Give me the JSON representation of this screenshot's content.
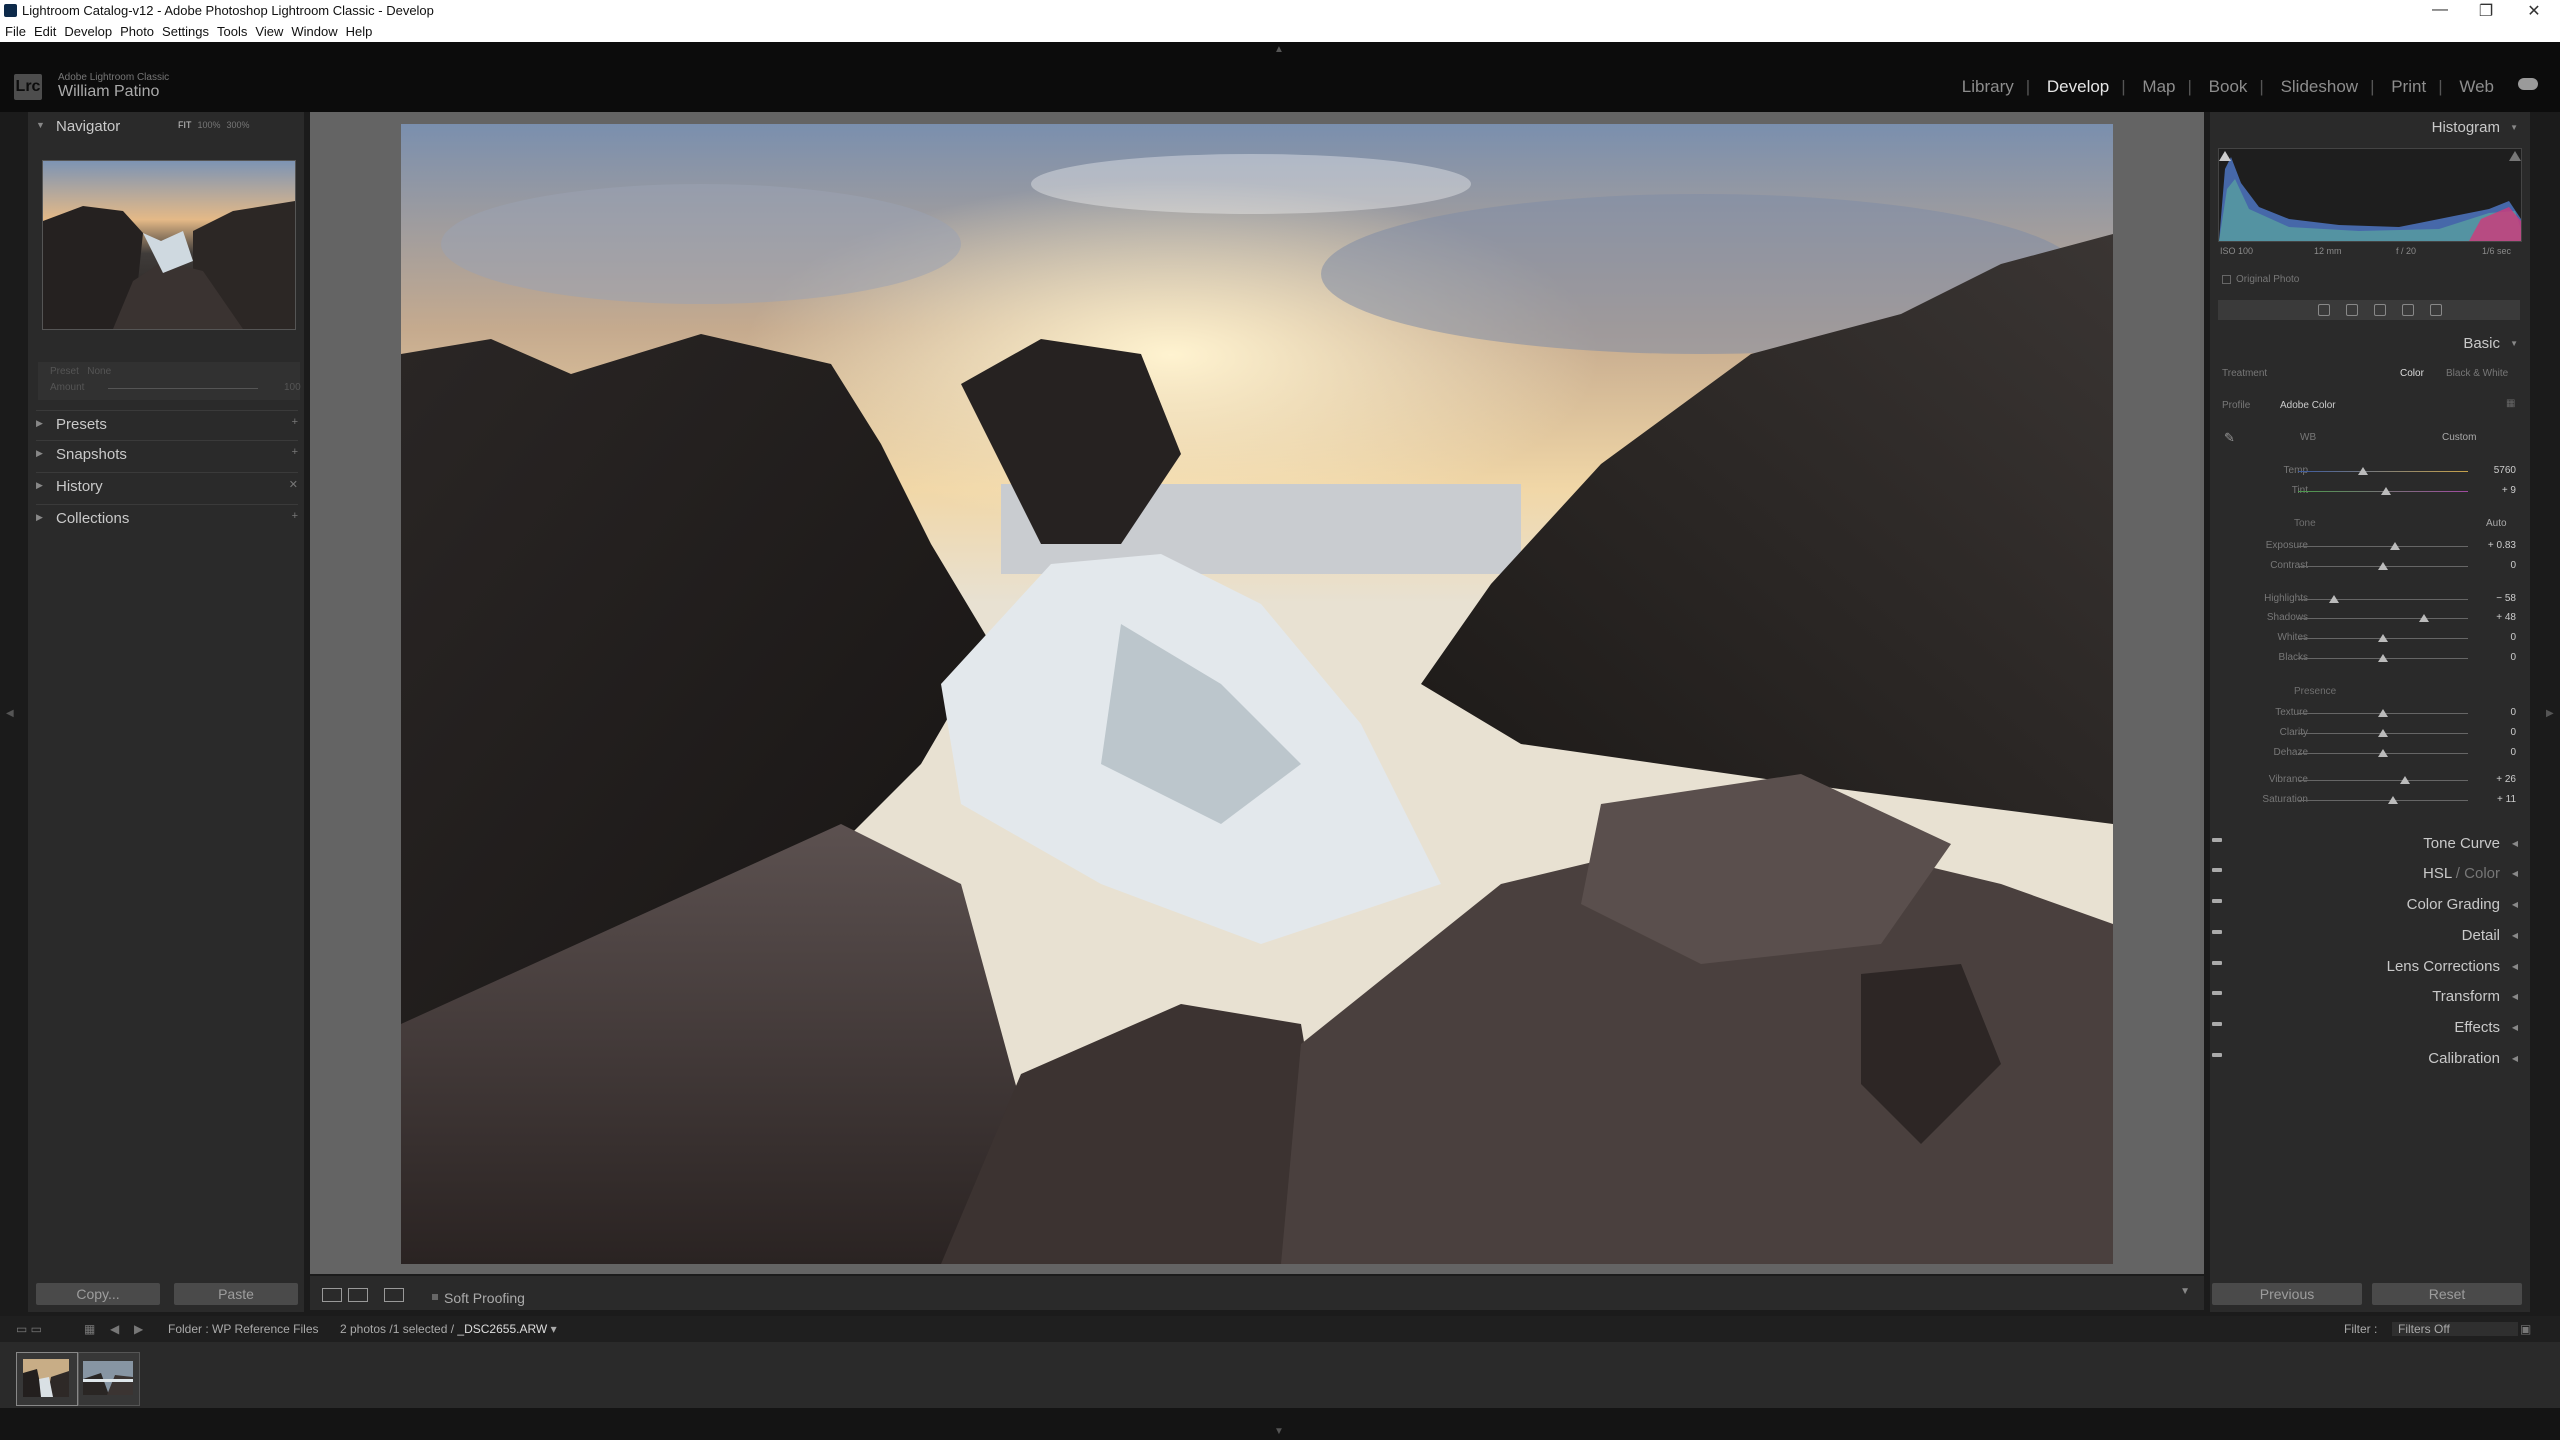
{
  "window": {
    "title": "Lightroom Catalog-v12 - Adobe Photoshop Lightroom Classic - Develop",
    "controls": {
      "minimize": "—",
      "maximize": "❐",
      "close": "✕"
    }
  },
  "menu": [
    "File",
    "Edit",
    "Develop",
    "Photo",
    "Settings",
    "Tools",
    "View",
    "Window",
    "Help"
  ],
  "identity": {
    "badge": "Lrc",
    "app_name": "Adobe Lightroom Classic",
    "user": "William Patino"
  },
  "modules": {
    "items": [
      "Library",
      "Develop",
      "Map",
      "Book",
      "Slideshow",
      "Print",
      "Web"
    ],
    "active": "Develop"
  },
  "left_panel": {
    "navigator": {
      "label": "Navigator",
      "zoom_options": [
        "FIT",
        "100%",
        "300%"
      ],
      "zoom_selected": "FIT"
    },
    "preset_amount": {
      "label1": "Preset",
      "label2": "None",
      "label3": "Amount",
      "value": "100"
    },
    "sections": [
      "Presets",
      "Snapshots",
      "History",
      "Collections"
    ],
    "copy_button": "Copy...",
    "paste_button": "Paste"
  },
  "toolbar": {
    "soft_proofing": "Soft Proofing"
  },
  "right_panel": {
    "histogram": {
      "label": "Histogram",
      "iso": "ISO 100",
      "focal": "12 mm",
      "aperture": "f / 20",
      "shutter": "1/6 sec",
      "original_photo": "Original Photo"
    },
    "basic": {
      "label": "Basic",
      "treatment_label": "Treatment",
      "treatment_options": [
        "Color",
        "Black & White"
      ],
      "treatment_selected": "Color",
      "profile_label": "Profile",
      "profile_value": "Adobe Color",
      "wb_label": "WB",
      "wb_value": "Custom",
      "tone_label": "Tone",
      "auto_label": "Auto",
      "presence_label": "Presence",
      "sliders": [
        {
          "label": "Temp",
          "value": "5760",
          "pos": 0.38
        },
        {
          "label": "Tint",
          "value": "+ 9",
          "pos": 0.52
        },
        {
          "label": "Exposure",
          "value": "+ 0.83",
          "pos": 0.57
        },
        {
          "label": "Contrast",
          "value": "0",
          "pos": 0.5
        },
        {
          "label": "Highlights",
          "value": "− 58",
          "pos": 0.21
        },
        {
          "label": "Shadows",
          "value": "+ 48",
          "pos": 0.74
        },
        {
          "label": "Whites",
          "value": "0",
          "pos": 0.5
        },
        {
          "label": "Blacks",
          "value": "0",
          "pos": 0.5
        },
        {
          "label": "Texture",
          "value": "0",
          "pos": 0.5
        },
        {
          "label": "Clarity",
          "value": "0",
          "pos": 0.5
        },
        {
          "label": "Dehaze",
          "value": "0",
          "pos": 0.5
        },
        {
          "label": "Vibrance",
          "value": "+ 26",
          "pos": 0.63
        },
        {
          "label": "Saturation",
          "value": "+ 11",
          "pos": 0.56
        }
      ]
    },
    "panels": [
      "Tone Curve",
      "HSL",
      "Color Grading",
      "Detail",
      "Lens Corrections",
      "Transform",
      "Effects",
      "Calibration"
    ],
    "hsl_suffix": "Color",
    "previous_button": "Previous",
    "reset_button": "Reset"
  },
  "filmstrip": {
    "source_prefix": "Folder : ",
    "source": "WP Reference Files",
    "count": "2 photos /1 selected /",
    "filename": "_DSC2655.ARW",
    "filter_label": "Filter :",
    "filter_value": "Filters Off"
  }
}
